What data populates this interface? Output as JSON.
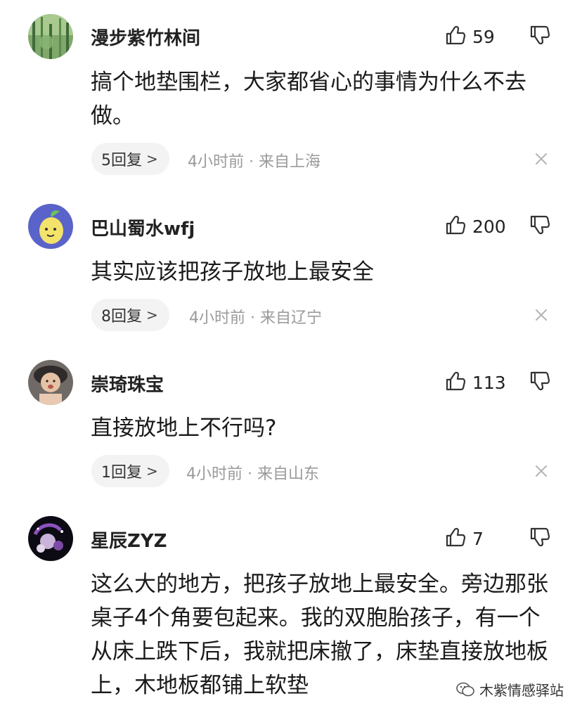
{
  "comments": [
    {
      "username": "漫步紫竹林间",
      "likes": "59",
      "content": "搞个地垫围栏，大家都省心的事情为什么不去做。",
      "reply_label": "5回复",
      "meta": "4小时前 · 来自上海"
    },
    {
      "username": "巴山蜀水wfj",
      "likes": "200",
      "content": "其实应该把孩子放地上最安全",
      "reply_label": "8回复",
      "meta": "4小时前 · 来自辽宁"
    },
    {
      "username": "崇琦珠宝",
      "likes": "113",
      "content": "直接放地上不行吗?",
      "reply_label": "1回复",
      "meta": "4小时前 · 来自山东"
    },
    {
      "username": "星辰ZYZ",
      "likes": "7",
      "content": "这么大的地方，把孩子放地上最安全。旁边那张桌子4个角要包起来。我的双胞胎孩子，有一个从床上跌下后，我就把床撤了，床垫直接放地板上，木地板都铺上软垫"
    }
  ],
  "icons": {
    "like": "thumbs-up-icon",
    "dislike": "thumbs-down-icon",
    "close": "close-icon",
    "reply_chevron": "chevron-right-icon"
  },
  "watermark": {
    "text": "木紫情感驿站"
  },
  "colors": {
    "meta_text": "#9a9a9a",
    "reply_pill_bg": "#f3f3f3",
    "text": "#1a1a1a"
  }
}
